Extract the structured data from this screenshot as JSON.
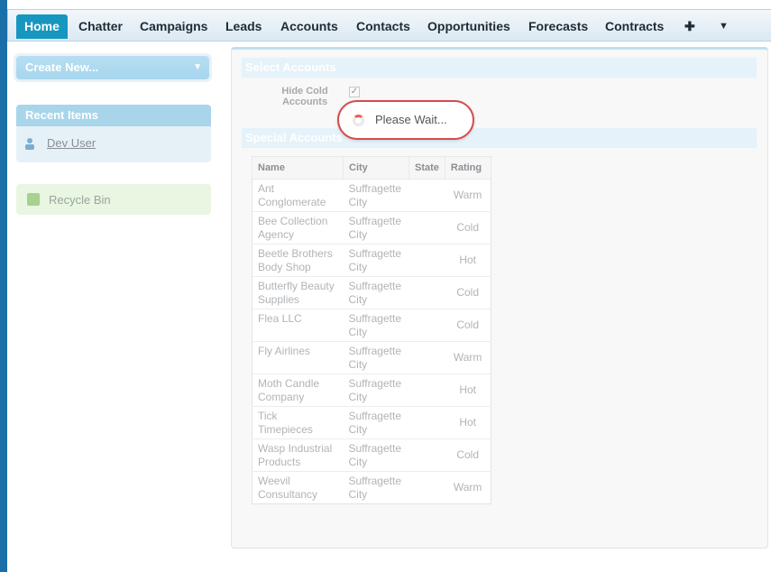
{
  "tabs": [
    {
      "label": "Home",
      "active": true
    },
    {
      "label": "Chatter"
    },
    {
      "label": "Campaigns"
    },
    {
      "label": "Leads"
    },
    {
      "label": "Accounts"
    },
    {
      "label": "Contacts"
    },
    {
      "label": "Opportunities"
    },
    {
      "label": "Forecasts"
    },
    {
      "label": "Contracts"
    }
  ],
  "tab_icons": {
    "plus": "✚",
    "more": "▼"
  },
  "sidebar": {
    "create_new_label": "Create New...",
    "recent_items_title": "Recent Items",
    "recent_items": [
      {
        "label": "Dev User"
      }
    ],
    "recycle_bin_label": "Recycle Bin"
  },
  "main": {
    "select_accounts_title": "Select Accounts",
    "hide_cold_label_1": "Hide Cold",
    "hide_cold_label_2": "Accounts",
    "hide_cold_checked": true,
    "special_accounts_title": "Special Accounts",
    "loading_text": "Please Wait..."
  },
  "table": {
    "headers": {
      "name": "Name",
      "city": "City",
      "state": "State",
      "rating": "Rating"
    },
    "rows": [
      {
        "name_1": "Ant",
        "name_2": "Conglomerate",
        "city_1": "Suffragette",
        "city_2": "City",
        "state": "",
        "rating": "Warm"
      },
      {
        "name_1": "Bee Collection",
        "name_2": "Agency",
        "city_1": "Suffragette",
        "city_2": "City",
        "state": "",
        "rating": "Cold"
      },
      {
        "name_1": "Beetle Brothers",
        "name_2": "Body Shop",
        "city_1": "Suffragette",
        "city_2": "City",
        "state": "",
        "rating": "Hot"
      },
      {
        "name_1": "Butterfly Beauty",
        "name_2": "Supplies",
        "city_1": "Suffragette",
        "city_2": "City",
        "state": "",
        "rating": "Cold"
      },
      {
        "name_1": "Flea LLC",
        "name_2": "",
        "city_1": "Suffragette",
        "city_2": "City",
        "state": "",
        "rating": "Cold"
      },
      {
        "name_1": "Fly Airlines",
        "name_2": "",
        "city_1": "Suffragette",
        "city_2": "City",
        "state": "",
        "rating": "Warm"
      },
      {
        "name_1": "Moth Candle",
        "name_2": "Company",
        "city_1": "Suffragette",
        "city_2": "City",
        "state": "",
        "rating": "Hot"
      },
      {
        "name_1": "Tick",
        "name_2": "Timepieces",
        "city_1": "Suffragette",
        "city_2": "City",
        "state": "",
        "rating": "Hot"
      },
      {
        "name_1": "Wasp Industrial",
        "name_2": "Products",
        "city_1": "Suffragette",
        "city_2": "City",
        "state": "",
        "rating": "Cold"
      },
      {
        "name_1": "Weevil",
        "name_2": "Consultancy",
        "city_1": "Suffragette",
        "city_2": "City",
        "state": "",
        "rating": "Warm"
      }
    ]
  },
  "colors": {
    "accent": "#1797c0",
    "section_bar": "#e5f2fa",
    "sidebar_header": "#a8d5ea",
    "loading_border": "#d84a4a"
  },
  "icons": {
    "user": "user-icon",
    "recycle": "recycle-bin-icon",
    "spinner": "spinner-icon"
  }
}
